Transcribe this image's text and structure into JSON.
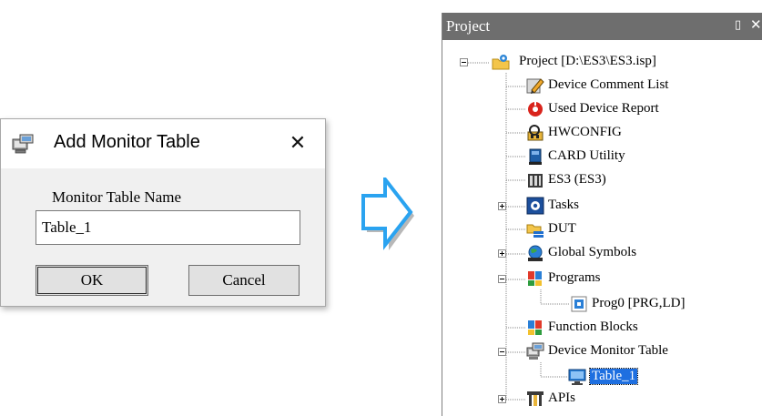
{
  "dialog": {
    "title": "Add Monitor Table",
    "close_glyph": "✕",
    "field_label": "Monitor Table Name",
    "input_value": "Table_1",
    "ok_label": "OK",
    "cancel_label": "Cancel"
  },
  "project_panel": {
    "title": "Project",
    "pin_glyph": "ᛜ",
    "close_glyph": "✕",
    "tree": [
      {
        "label": "Project [D:\\ES3\\ES3.isp]",
        "icon": "project-folder-icon",
        "expander": "minus",
        "selected": false
      },
      {
        "label": "Device Comment List",
        "icon": "comment-pencil-icon",
        "expander": null,
        "selected": false
      },
      {
        "label": "Used Device Report",
        "icon": "device-report-icon",
        "expander": null,
        "selected": false
      },
      {
        "label": "HWCONFIG",
        "icon": "hwconfig-icon",
        "expander": null,
        "selected": false
      },
      {
        "label": "CARD Utility",
        "icon": "card-icon",
        "expander": null,
        "selected": false
      },
      {
        "label": "ES3  (ES3)",
        "icon": "plc-icon",
        "expander": null,
        "selected": false
      },
      {
        "label": "Tasks",
        "icon": "tasks-gear-icon",
        "expander": "plus",
        "selected": false
      },
      {
        "label": "DUT",
        "icon": "dut-icon",
        "expander": null,
        "selected": false
      },
      {
        "label": "Global Symbols",
        "icon": "globe-icon",
        "expander": "plus",
        "selected": false
      },
      {
        "label": "Programs",
        "icon": "programs-blocks-icon",
        "expander": "minus",
        "selected": false
      },
      {
        "label": "Prog0 [PRG,LD]",
        "icon": "program-icon",
        "expander": null,
        "selected": false
      },
      {
        "label": "Function Blocks",
        "icon": "function-blocks-icon",
        "expander": null,
        "selected": false
      },
      {
        "label": "Device Monitor Table",
        "icon": "monitor-table-icon",
        "expander": "minus",
        "selected": false
      },
      {
        "label": "Table_1",
        "icon": "monitor-screen-icon",
        "expander": null,
        "selected": true
      },
      {
        "label": "APIs",
        "icon": "apis-icon",
        "expander": "plus",
        "selected": false
      }
    ]
  }
}
